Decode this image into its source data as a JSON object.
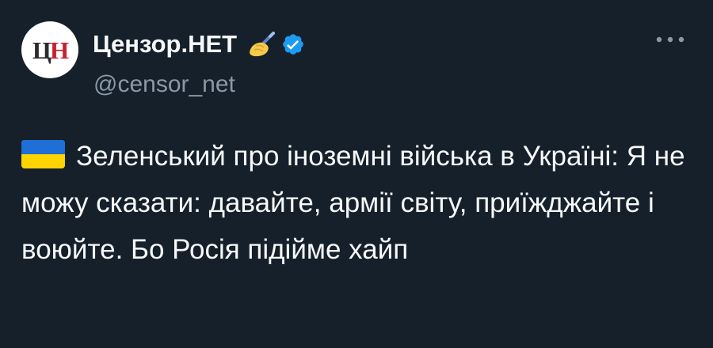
{
  "tweet": {
    "avatar": {
      "letter_1": "Ц",
      "letter_2": "Н",
      "colors": {
        "background": "#ffffff",
        "letter_1": "#2b2b2b",
        "letter_2": "#c8202f"
      }
    },
    "author": {
      "display_name": "Цензор.НЕТ",
      "name_emoji_icon": "writing-hand-icon",
      "verified_icon": "verified-badge-icon",
      "handle": "@censor_net"
    },
    "more_options_icon": "more-horizontal-icon",
    "body": {
      "flag_icon": "ukraine-flag-icon",
      "text": "Зеленський про іноземні війська в Україні: Я не можу сказати: давайте, армії світу, приїжджайте і воюйте. Бо Росія підійме хайп"
    },
    "colors": {
      "background": "#15202b",
      "primary_text": "#f7f9f9",
      "secondary_text": "#8b98a5",
      "verified_blue": "#1d9bf0",
      "flag_blue": "#1f6fd6",
      "flag_yellow": "#ffd400"
    }
  }
}
